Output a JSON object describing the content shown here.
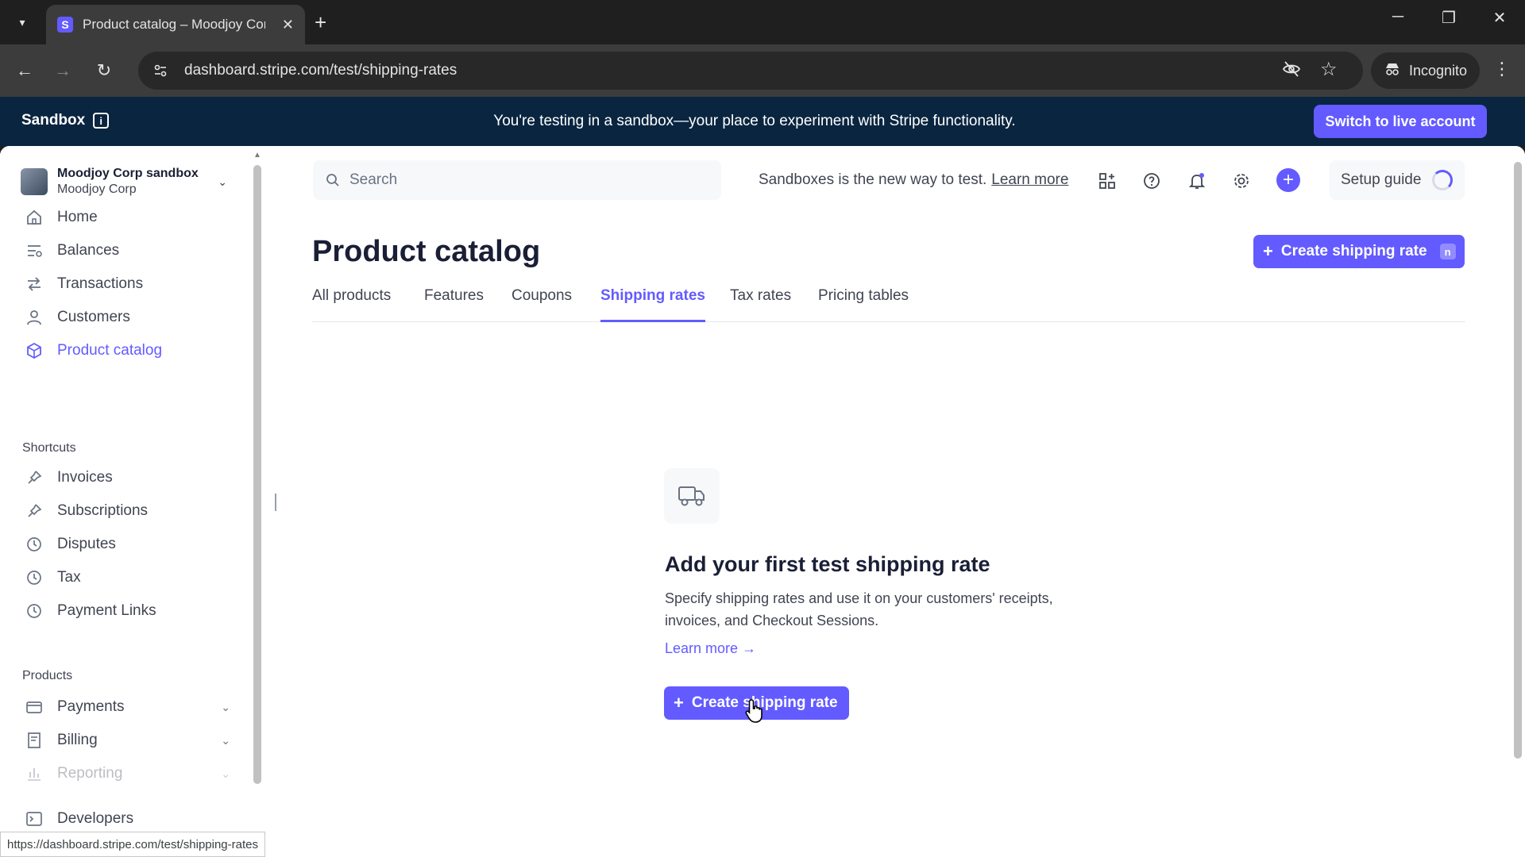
{
  "browser": {
    "tab_title": "Product catalog – Moodjoy Cor",
    "tab_favicon": "S",
    "url": "dashboard.stripe.com/test/shipping-rates",
    "incognito_label": "Incognito"
  },
  "banner": {
    "label": "Sandbox",
    "message": "You're testing in a sandbox—your place to experiment with Stripe functionality.",
    "live_button": "Switch to live account"
  },
  "account": {
    "name": "Moodjoy Corp sandbox",
    "sub": "Moodjoy Corp"
  },
  "sidebar": {
    "main_items": [
      {
        "label": "Home",
        "icon": "home-icon"
      },
      {
        "label": "Balances",
        "icon": "balances-icon"
      },
      {
        "label": "Transactions",
        "icon": "transactions-icon"
      },
      {
        "label": "Customers",
        "icon": "customers-icon"
      },
      {
        "label": "Product catalog",
        "icon": "product-catalog-icon",
        "active": true
      }
    ],
    "shortcuts_label": "Shortcuts",
    "shortcuts": [
      {
        "label": "Invoices",
        "icon": "pin-icon"
      },
      {
        "label": "Subscriptions",
        "icon": "pin-icon"
      },
      {
        "label": "Disputes",
        "icon": "clock-icon"
      },
      {
        "label": "Tax",
        "icon": "clock-icon"
      },
      {
        "label": "Payment Links",
        "icon": "clock-icon"
      }
    ],
    "products_label": "Products",
    "products": [
      {
        "label": "Payments",
        "icon": "payments-icon"
      },
      {
        "label": "Billing",
        "icon": "billing-icon"
      },
      {
        "label": "Reporting",
        "icon": "reporting-icon"
      }
    ],
    "developers": "Developers"
  },
  "status_url": "https://dashboard.stripe.com/test/shipping-rates",
  "header": {
    "search_placeholder": "Search",
    "hint_text": "Sandboxes is the new way to test.",
    "hint_link": "Learn more",
    "setup_guide": "Setup guide"
  },
  "page": {
    "title": "Product catalog",
    "create_button": "Create shipping rate",
    "create_shortcut": "n",
    "tabs": [
      {
        "label": "All products"
      },
      {
        "label": "Features"
      },
      {
        "label": "Coupons"
      },
      {
        "label": "Shipping rates",
        "active": true
      },
      {
        "label": "Tax rates"
      },
      {
        "label": "Pricing tables"
      }
    ]
  },
  "empty_state": {
    "title": "Add your first test shipping rate",
    "description": "Specify shipping rates and use it on your customers' receipts, invoices, and Checkout Sessions.",
    "link": "Learn more →",
    "button": "Create shipping rate"
  },
  "colors": {
    "accent": "#635bff",
    "banner_bg": "#0a2540"
  }
}
